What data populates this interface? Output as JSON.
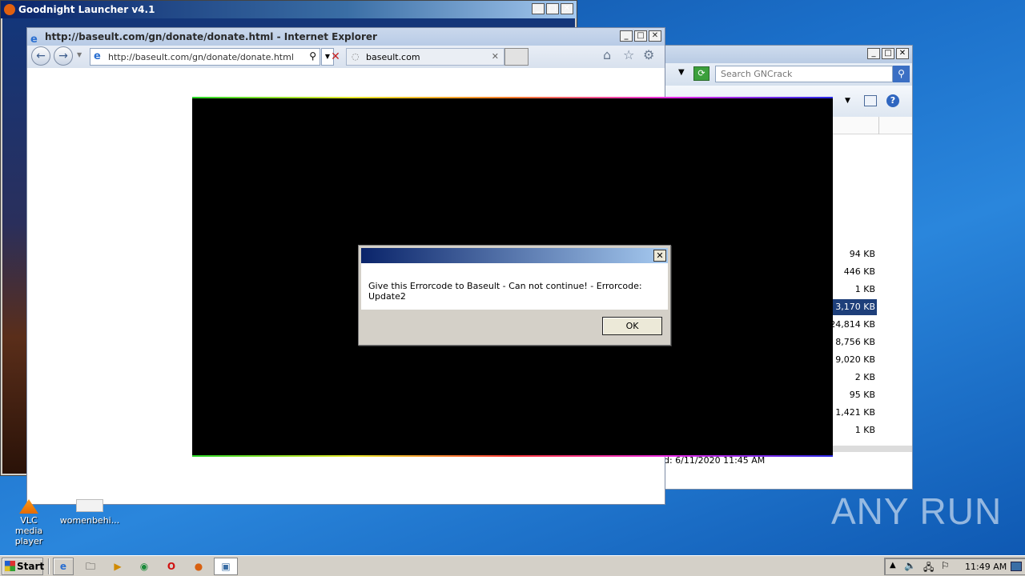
{
  "launcher": {
    "title": "Goodnight Launcher v4.1"
  },
  "explorer": {
    "search_placeholder": "Search GNCrack",
    "status_text": "d: 6/11/2020 11:45 AM",
    "sizes": [
      "94 KB",
      "446 KB",
      "1 KB",
      "3,170 KB",
      "24,814 KB",
      "8,756 KB",
      "9,020 KB",
      "2 KB",
      "95 KB",
      "1,421 KB",
      "1 KB"
    ],
    "selected_index": 3
  },
  "ie": {
    "title": "http://baseult.com/gn/donate/donate.html - Internet Explorer",
    "url": "http://baseult.com/gn/donate/donate.html",
    "tab_label": "baseult.com"
  },
  "dialog": {
    "message": "Give this Errorcode to Baseult - Can not continue! - Errorcode: Update2",
    "ok_label": "OK",
    "close_glyph": "✕"
  },
  "desktop": {
    "icons": [
      {
        "label": "VLC media player",
        "icon": "vlc-icon"
      },
      {
        "label": "womenbehi...",
        "icon": "document-icon"
      }
    ]
  },
  "taskbar": {
    "start_label": "Start",
    "clock": "11:49 AM",
    "pinned": [
      "ie-icon",
      "explorer-icon",
      "media-player-icon",
      "chrome-icon",
      "opera-icon",
      "launcher-icon",
      "window-icon"
    ]
  },
  "watermark": "ANY RUN"
}
